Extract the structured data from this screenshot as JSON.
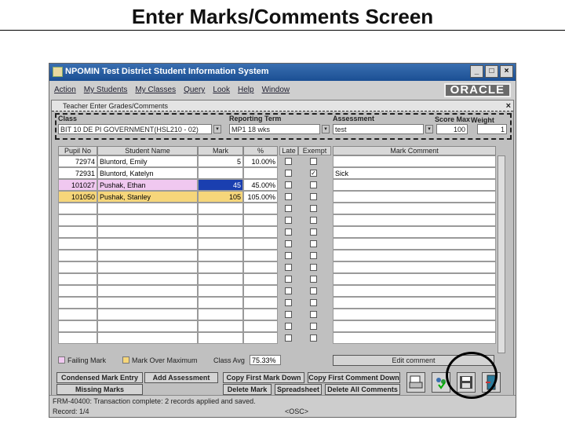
{
  "slide": {
    "title": "Enter Marks/Comments Screen"
  },
  "window": {
    "title": "NPOMIN Test District Student Information System",
    "buttons": [
      "_",
      "□",
      "×"
    ],
    "menu": [
      "Action",
      "My Students",
      "My Classes",
      "Query",
      "Look",
      "Help",
      "Window"
    ],
    "brand": "ORACLE"
  },
  "form": {
    "title": "Teacher Enter Grades/Comments",
    "class_label": "Class",
    "class_value": "BIT 10 DE PI GOVERNMENT(HSL210 - 02)",
    "term_label": "Reporting Term",
    "term_value": "MP1 18 wks",
    "assessment_label": "Assessment",
    "assessment_value": "test",
    "score_max_label": "Score Max",
    "score_max_value": "100",
    "weight_label": "Weight",
    "weight_value": "1"
  },
  "grid": {
    "columns": [
      "Pupil No",
      "Student Name",
      "Mark",
      "%",
      "Late",
      "Exempt",
      "Mark Comment"
    ],
    "rows": [
      {
        "pupil": "72974",
        "name": "Bluntord, Emily",
        "mark": "5",
        "pct": "10.00%",
        "late": false,
        "exempt": false,
        "comment": ""
      },
      {
        "pupil": "72931",
        "name": "Bluntord, Katelyn",
        "mark": "",
        "pct": "",
        "late": false,
        "exempt": true,
        "comment": "Sick"
      },
      {
        "pupil": "101027",
        "name": "Pushak, Ethan",
        "mark": "45",
        "pct": "45.00%",
        "late": false,
        "exempt": false,
        "comment": ""
      },
      {
        "pupil": "101050",
        "name": "Pushak, Stanley",
        "mark": "105",
        "pct": "105.00%",
        "late": false,
        "exempt": false,
        "comment": ""
      }
    ]
  },
  "legend": {
    "failing": "Failing Mark",
    "over_max": "Mark Over Maximum",
    "class_avg_label": "Class Avg",
    "class_avg_value": "75.33%",
    "edit_comment": "Edit comment",
    "failing_color": "#f0c8f0",
    "over_max_color": "#f6d67a"
  },
  "buttons": {
    "condensed": "Condensed Mark Entry",
    "add_assessment": "Add Assessment",
    "copy_first_mark": "Copy First Mark Down",
    "copy_first_comment": "Copy First Comment Down",
    "missing_marks": "Missing Marks",
    "delete_mark": "Delete Mark",
    "spreadsheet": "Spreadsheet",
    "delete_all_comments": "Delete All Comments"
  },
  "status": {
    "message": "FRM-40400: Transaction complete: 2 records applied and saved.",
    "record": "Record: 1/4",
    "osc": "<OSC>"
  },
  "icons": [
    "printer-icon",
    "users-icon",
    "save-icon",
    "exit-icon"
  ]
}
